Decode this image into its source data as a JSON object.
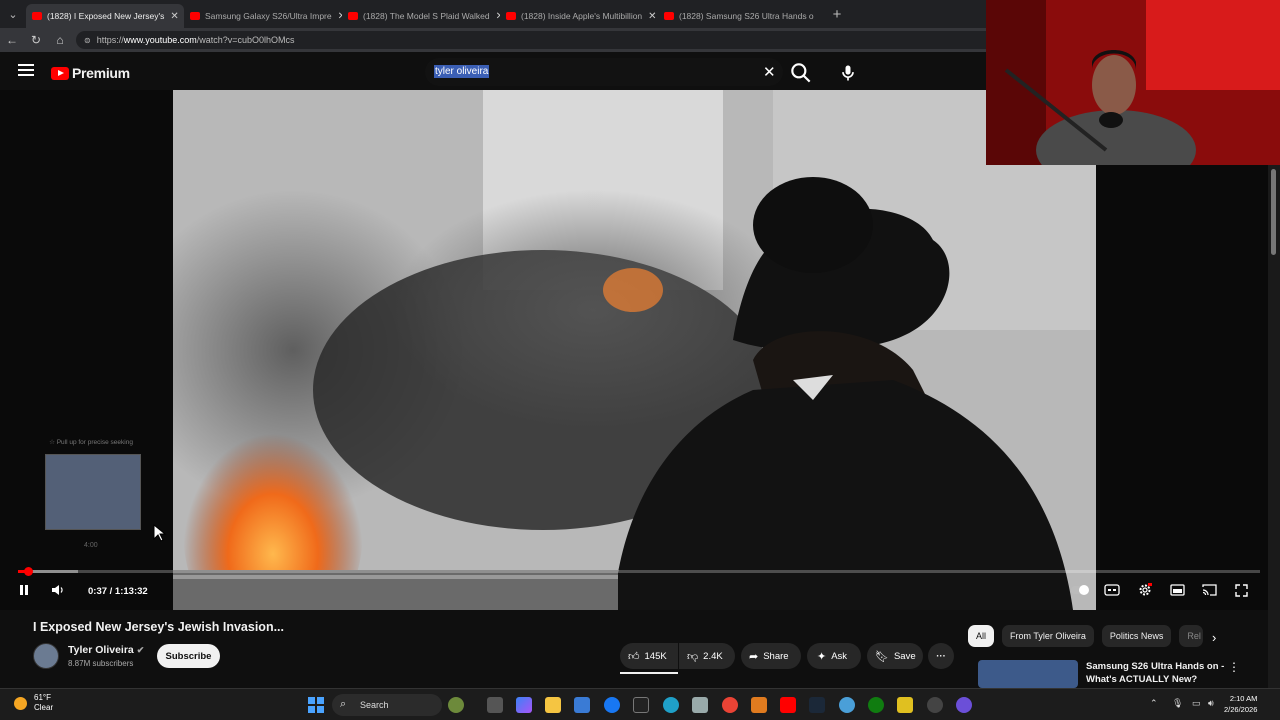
{
  "tabs": [
    {
      "label": "(1828) I Exposed New Jersey's",
      "active": true
    },
    {
      "label": "Samsung Galaxy S26/Ultra Impre",
      "active": false
    },
    {
      "label": "(1828) The Model S Plaid Walked",
      "active": false
    },
    {
      "label": "(1828) Inside Apple's Multibillion",
      "active": false
    },
    {
      "label": "(1828) Samsung S26 Ultra Hands o",
      "active": false
    }
  ],
  "address": {
    "prefix": "https://",
    "host": "www.youtube.com",
    "path": "/watch?v=cubO0lhOMcs"
  },
  "header": {
    "brand": "Premium",
    "search_query": "tyler oliveira"
  },
  "player": {
    "preview_hint": "☆ Pull up for precise seeking",
    "preview_time": "4:00",
    "current_time": "0:37",
    "duration": "1:13:32",
    "time_display": "0:37 / 1:13:32",
    "progress": 0.0084
  },
  "video": {
    "title": "I Exposed New Jersey's Jewish Invasion...",
    "channel": "Tyler Oliveira",
    "subscribers": "8.87M subscribers",
    "subscribe_label": "Subscribe",
    "likes": "145K",
    "dislikes": "2.4K",
    "share_label": "Share",
    "ask_label": "Ask",
    "save_label": "Save"
  },
  "chips": [
    "All",
    "From Tyler Oliveira",
    "Politics News",
    "Rel"
  ],
  "recommendation": {
    "title": "Samsung S26 Ultra Hands on - What's ACTUALLY New?"
  },
  "taskbar": {
    "temp": "61°F",
    "condition": "Clear",
    "search_label": "Search",
    "time": "2:10 AM",
    "date": "2/26/2026"
  }
}
